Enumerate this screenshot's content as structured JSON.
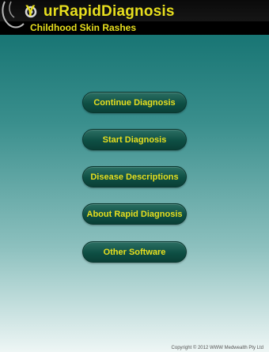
{
  "header": {
    "title_prefix": "Y",
    "title_rest": "urRapidDiagnosis",
    "subtitle": "Childhood Skin Rashes"
  },
  "menu": {
    "items": [
      {
        "label": "Continue Diagnosis"
      },
      {
        "label": "Start Diagnosis"
      },
      {
        "label": "Disease Descriptions"
      },
      {
        "label": "About Rapid Diagnosis"
      },
      {
        "label": "Other Software"
      }
    ]
  },
  "footer": {
    "copyright": "Copyright © 2012 WWW Medwealth Pty Ltd"
  },
  "colors": {
    "accent": "#e8df1e",
    "button": "#0e4f44"
  },
  "icons": {
    "logo": "stethoscope-icon"
  }
}
